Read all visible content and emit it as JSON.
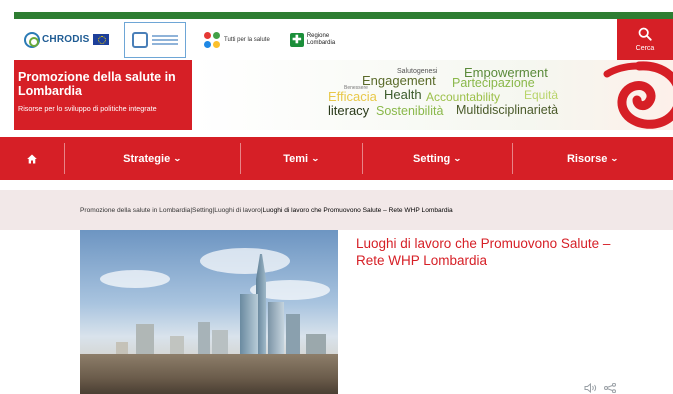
{
  "header": {
    "logos": {
      "chrodis": "CHRODIS",
      "tutti": "Tutti per la salute",
      "regione_line1": "Regione",
      "regione_line2": "Lombardia"
    },
    "search_label": "Cerca"
  },
  "banner": {
    "title": "Promozione della salute in Lombardia",
    "subtitle": "Risorse per lo sviluppo di politiche integrate",
    "words": [
      {
        "text": "Salutogenesi",
        "color": "#555555"
      },
      {
        "text": "Engagement",
        "color": "#5a6a2a"
      },
      {
        "text": "Empowerment",
        "color": "#5a8a3a"
      },
      {
        "text": "Partecipazione",
        "color": "#8ab84a"
      },
      {
        "text": "Benessere",
        "color": "#777777"
      },
      {
        "text": "Efficacia",
        "color": "#e8c84a"
      },
      {
        "text": "Health",
        "color": "#3a5a2a"
      },
      {
        "text": "Accountability",
        "color": "#9cc04a"
      },
      {
        "text": "Equità",
        "color": "#b8d46a"
      },
      {
        "text": "literacy",
        "color": "#2a3a1a"
      },
      {
        "text": "Sostenibilità",
        "color": "#8ab84a"
      },
      {
        "text": "Multidisciplinarietà",
        "color": "#4a5a2a"
      }
    ]
  },
  "nav": {
    "items": [
      {
        "label": "Strategie",
        "chevron": "❯"
      },
      {
        "label": "Temi",
        "chevron": "❯"
      },
      {
        "label": "Setting",
        "chevron": "❯"
      },
      {
        "label": "Risorse",
        "chevron": "❯"
      }
    ]
  },
  "breadcrumb": {
    "items": [
      "Promozione della salute in Lombardia",
      "Setting",
      "Luoghi di lavoro"
    ],
    "separator": " | ",
    "current": "Luoghi di lavoro che Promuovono Salute – Rete WHP Lombardia"
  },
  "article": {
    "title": "Luoghi di lavoro che Promuovono Salute – Rete WHP Lombardia"
  },
  "colors": {
    "brand_red": "#d61f26",
    "brand_green": "#2e7d32",
    "breadcrumb_bg": "#f2e8e8"
  },
  "icons": {
    "search": "search-icon",
    "home": "home-icon",
    "audio": "speaker-icon",
    "share": "share-icon"
  }
}
